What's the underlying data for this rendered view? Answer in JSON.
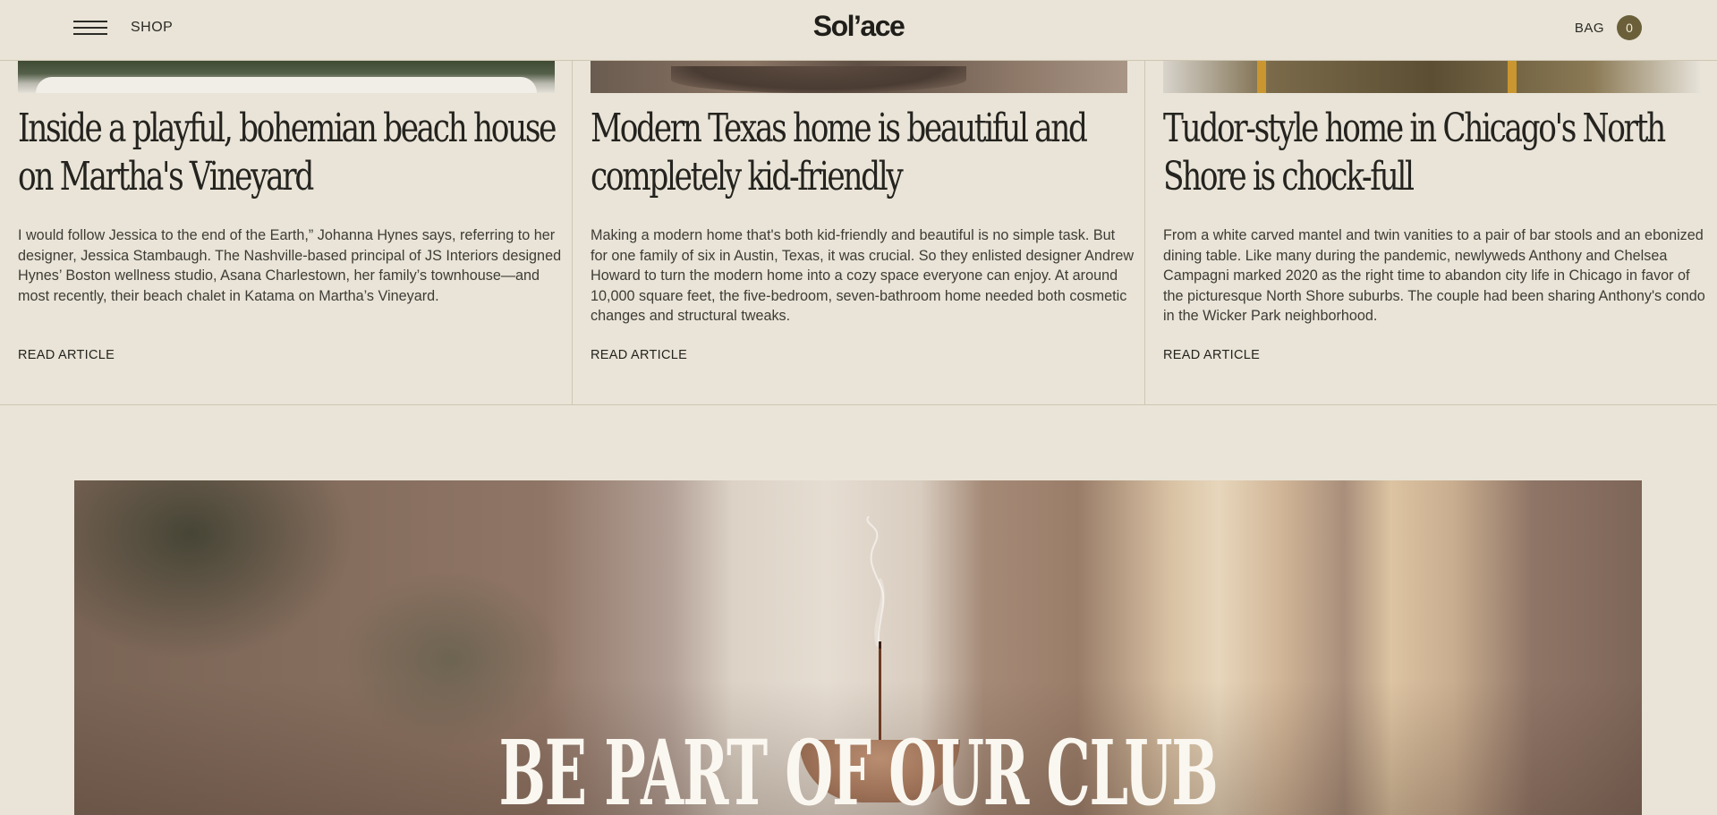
{
  "header": {
    "shop_label": "SHOP",
    "logo": "Sol’ace",
    "bag_label": "BAG",
    "bag_count": "0"
  },
  "articles": [
    {
      "title": "Inside a playful, bohemian beach house on Martha's Vineyard",
      "body": "I would follow Jessica to the end of the Earth,” Johanna Hynes says, referring to her designer, Jessica Stambaugh. The Nashville-based principal of JS Interiors designed Hynes’ Boston wellness studio, Asana Charlestown, her family’s townhouse—and most recently, their beach chalet in Katama on Martha’s Vineyard.",
      "link": "READ ARTICLE"
    },
    {
      "title": "Modern Texas home is beautiful and completely kid-friendly",
      "body": "Making a modern home that's both kid-friendly and beautiful is no simple task. But for one family of six in Austin, Texas, it was crucial. So they enlisted designer Andrew Howard to turn the modern home into a cozy space everyone can enjoy. At around 10,000 square feet, the five-bedroom, seven-bathroom home needed both cosmetic changes and structural tweaks.",
      "link": "READ ARTICLE"
    },
    {
      "title": "Tudor-style home in Chicago's North Shore is chock-full",
      "body": "From a white carved mantel and twin vanities to a pair of bar stools and an ebonized dining table. Like many during the pandemic, newlyweds Anthony and Chelsea Campagni marked 2020 as the right time to abandon city life in Chicago in favor of the picturesque North Shore suburbs. The couple had been sharing Anthony's condo in the Wicker Park neighborhood.",
      "link": "READ ARTICLE"
    }
  ],
  "club": {
    "title": "BE PART OF OUR CLUB"
  },
  "colors": {
    "background": "#e9e4d7",
    "bag_badge": "#6b5f3a",
    "text": "#2b2a25"
  }
}
